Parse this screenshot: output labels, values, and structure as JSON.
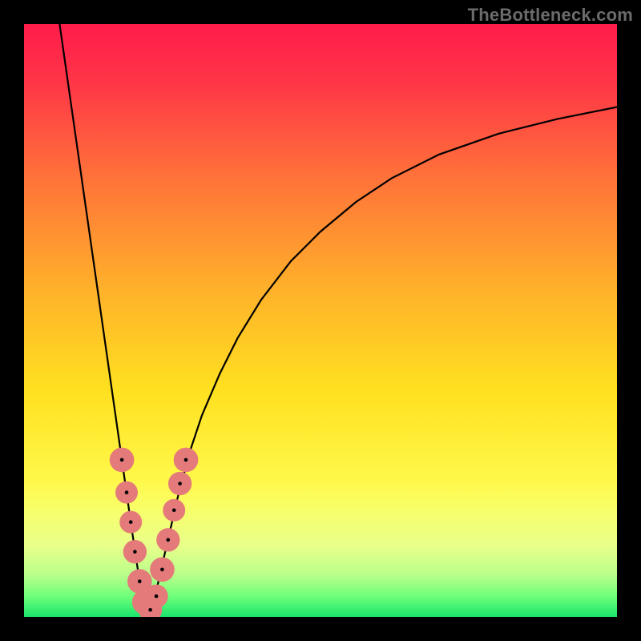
{
  "watermark": "TheBottleneck.com",
  "chart_data": {
    "type": "line",
    "title": "",
    "xlabel": "",
    "ylabel": "",
    "xlim": [
      0,
      100
    ],
    "ylim": [
      0,
      100
    ],
    "grid": false,
    "background_gradient_stops": [
      {
        "offset": 0.0,
        "color": "#ff1c4b"
      },
      {
        "offset": 0.1,
        "color": "#ff3647"
      },
      {
        "offset": 0.25,
        "color": "#ff6f3a"
      },
      {
        "offset": 0.45,
        "color": "#ffb22a"
      },
      {
        "offset": 0.62,
        "color": "#ffe120"
      },
      {
        "offset": 0.77,
        "color": "#fff84a"
      },
      {
        "offset": 0.82,
        "color": "#f8ff6a"
      },
      {
        "offset": 0.88,
        "color": "#e8ff8a"
      },
      {
        "offset": 0.93,
        "color": "#b8ff8a"
      },
      {
        "offset": 0.965,
        "color": "#6fff7a"
      },
      {
        "offset": 1.0,
        "color": "#19e56b"
      }
    ],
    "series": [
      {
        "name": "bottleneck-curve-left",
        "x": [
          6.0,
          7.0,
          8.0,
          9.0,
          10.0,
          11.0,
          12.0,
          13.0,
          14.0,
          15.0,
          16.0,
          17.0,
          18.0,
          18.8,
          19.5,
          20.3,
          21.0
        ],
        "y": [
          100,
          93.0,
          86.0,
          79.0,
          72.0,
          65.0,
          58.0,
          51.0,
          44.0,
          37.0,
          30.0,
          23.0,
          16.0,
          10.5,
          6.0,
          2.5,
          0.5
        ]
      },
      {
        "name": "bottleneck-curve-right",
        "x": [
          21.0,
          22.0,
          23.0,
          24.5,
          26.0,
          28.0,
          30.0,
          33.0,
          36.0,
          40.0,
          45.0,
          50.0,
          56.0,
          62.0,
          70.0,
          80.0,
          90.0,
          100.0
        ],
        "y": [
          0.5,
          3.0,
          7.5,
          14.0,
          20.5,
          28.0,
          34.0,
          41.0,
          47.0,
          53.5,
          60.0,
          65.0,
          70.0,
          74.0,
          78.0,
          81.5,
          84.0,
          86.0
        ]
      }
    ],
    "markers": {
      "name": "highlighted-points",
      "points": [
        {
          "x": 16.5,
          "y": 26.5,
          "r": 1.4
        },
        {
          "x": 17.3,
          "y": 21.0,
          "r": 1.2
        },
        {
          "x": 18.0,
          "y": 16.0,
          "r": 1.2
        },
        {
          "x": 18.7,
          "y": 11.0,
          "r": 1.3
        },
        {
          "x": 19.5,
          "y": 6.0,
          "r": 1.4
        },
        {
          "x": 20.3,
          "y": 2.5,
          "r": 1.4
        },
        {
          "x": 21.3,
          "y": 1.2,
          "r": 1.3
        },
        {
          "x": 22.3,
          "y": 3.5,
          "r": 1.3
        },
        {
          "x": 23.3,
          "y": 8.0,
          "r": 1.4
        },
        {
          "x": 24.3,
          "y": 13.0,
          "r": 1.3
        },
        {
          "x": 25.3,
          "y": 18.0,
          "r": 1.2
        },
        {
          "x": 26.3,
          "y": 22.5,
          "r": 1.3
        },
        {
          "x": 27.3,
          "y": 26.5,
          "r": 1.4
        }
      ]
    }
  }
}
